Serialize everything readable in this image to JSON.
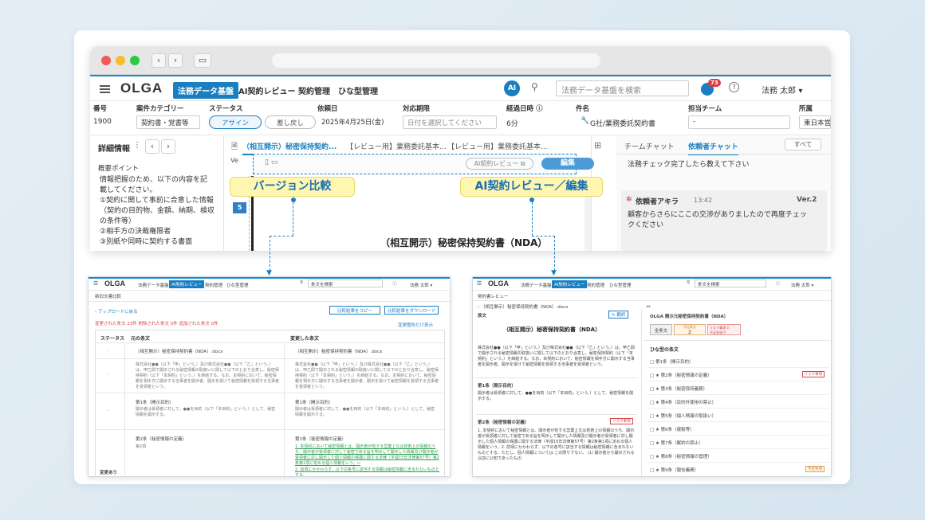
{
  "app": {
    "logo": "OLGA",
    "nav": [
      "法務データ基盤",
      "AI契約レビュー",
      "契約管理",
      "ひな型管理"
    ],
    "ai": "AI",
    "search_placeholder": "法務データ基盤を検索",
    "notif_count": "73",
    "user": "法務 太郎 ▾"
  },
  "fields": {
    "labels": [
      "番号",
      "案件カテゴリー",
      "ステータス",
      "依頼日",
      "対応期限",
      "経過日時 ⓘ",
      "件名",
      "担当チーム",
      "所属"
    ],
    "number": "1900",
    "category": "契約書・覚書等",
    "status_a": "アサイン",
    "status_b": "差し戻し",
    "request_date": "2025年4月25日(金)",
    "deadline_placeholder": "日付を選択してください",
    "elapsed": "6分",
    "subject": "G社/業務委託契約書",
    "team": "-",
    "dept": "東日本営"
  },
  "left": {
    "title": "詳細情報",
    "heading": "概要ポイント",
    "lines": [
      "情報把握のため、以下の内容を記",
      "載してください。",
      "①契約に関して事前に合意した情報",
      "（契約の目的物、金額、納期、検収",
      "の条件等）",
      "②相手方の決裁権限者",
      "③別紙や同時に契約する書面"
    ]
  },
  "mid": {
    "tabs": [
      "（相互開示）秘密保持契約...",
      "【レビュー用】業務委託基本...",
      "【レビュー用】業務委託基本..."
    ],
    "review_btn": "AI契約レビュー ⧉",
    "edit_btn": "編集",
    "page": "5",
    "doc_title": "（相互開示）秘密保持契約書（NDA）",
    "ver": "Ve"
  },
  "callouts": {
    "left": "バージョン比較",
    "right": "AI契約レビュー／編集"
  },
  "chat": {
    "tabs": [
      "チームチャット",
      "依頼者チャット"
    ],
    "all": "すべて",
    "msg1": "法務チェック完了したら教えて下さい",
    "user": "依頼者アキラ",
    "time": "13:42",
    "ver": "Ver.2",
    "msg2": "顧客からさらにここの交渉がありましたので再度チェックください"
  },
  "shot1": {
    "logo": "OLGA",
    "nav": [
      "法務データ基盤",
      "AI契約レビュー",
      "契約管理",
      "ひな型管理"
    ],
    "search": "条文を検索",
    "user": "法務 太郎 ▾",
    "crumb": "新旧文書比較",
    "back": "‹ アップロードに戻る",
    "copy": "比較結果をコピー",
    "download": "比較結果をダウンロード",
    "warn": "変更された条文 23件 削除された条文 0件 追加された条文 0件",
    "only": "変更箇所だけ表示",
    "cols": [
      "ステータス",
      "元の条文",
      "変更した条文"
    ],
    "doc": "（相互開示）秘密保持契約書（NDA）.docx",
    "p1": "株式会社●●（以下「甲」という。）及び株式会社●●（以下「乙」という。）は、甲乙間で開示される秘密情報の取扱いに関して以下のとおり合意し、秘密保持契約（以下「本契約」という。）を締結する。なお、本契約において、秘密情報を相手方に開示する当事者を開示者、開示を受けて秘密情報を受領する当事者を受領者という。",
    "a1": "第1条（開示目的）",
    "a1t": "開示者は受領者に対して、●●を目的（以下「本目的」という。）として、秘密情報を開示する。",
    "a2": "第2条（秘密情報の定義）",
    "a2s": "第2項",
    "chg": "変更あり",
    "g1": "1. 本契約において秘密情報とは、開示者が有する営業上又は技術上の情報のうち、開示者が受領者に対して秘密である旨を明示して開示した情報及び開示者が受領者に対し開示した個人情報の保護に関する法律（平成15年法律第57号）第2条第1項に定める個人情報をいう。↵",
    "g2": "2. 前項にかかわらず、以下の各号に該当する情報は秘密情報に含まれないものとする。"
  },
  "shot2": {
    "logo": "OLGA",
    "nav": [
      "法務データ基盤",
      "AI契約レビュー",
      "契約管理",
      "ひな型管理"
    ],
    "search": "条文を検索",
    "user": "法務 太郎 ▾",
    "crumb": "契約書レビュー",
    "file": "‹ （相互開示）秘密保持契約書（NDA）.docx",
    "tool": "✎ 翻訳",
    "lbl": "原文",
    "title": "（相互開示）秘密保持契約書（NDA）",
    "p1": "株式会社●●（以下「甲」という。）及び株式会社●●（以下「乙」という。）は、甲乙間で開示される秘密情報の取扱いに関して以下のとおり合意し、秘密保持契約（以下「本契約」という。）を締結する。なお、本契約において、秘密情報を相手方に開示する当事者を開示者、開示を受けて秘密情報を受領する当事者を受領者という。",
    "a1": "第1条（開示目的）",
    "a1t": "開示者は受領者に対して、●●を目的（以下「本目的」という。）として、秘密情報を開示する。",
    "a2": "第2条（秘密情報の定義）",
    "risk": "リスク事項",
    "a2t": "1. 本契約において秘密情報とは、開示者が有する営業上又は技術上の情報のうち、開示者が受領者に対して秘密である旨を明示して開示した情報及び開示者が受領者に対し開示した個人情報の保護に関する法律（平成15年法律第57号）第2条第1項に定める個人情報をいう。2. 前項にかかわらず、以下の各号に該当する情報は秘密情報に含まれないものとする。ただし、個人情報については この限りでない。 (1) 開示者から開示される以前に公知であったもの",
    "side_title": "OLGA 開示元秘密保持契約書（NDA）",
    "st_labels": [
      "全条文",
      "不足条文",
      "リスク事項 3",
      "不足条項 0"
    ],
    "st_vals": [
      "",
      "2",
      "3",
      "0"
    ],
    "list_head": "ひな型の条文",
    "items": [
      "第1条（開示目的）",
      "第2条（秘密情報の定義）",
      "第3条（秘密保持義務）",
      "第4条（目的外使用の禁止）",
      "第5条（個人情報の取扱い）",
      "第6条（複製等）",
      "第7条（解約の禁止）",
      "第8条（秘密情報の管理）",
      "第9条（報告義務）"
    ],
    "tag_risk": "リスク事項",
    "tag_short": "不足条項"
  }
}
